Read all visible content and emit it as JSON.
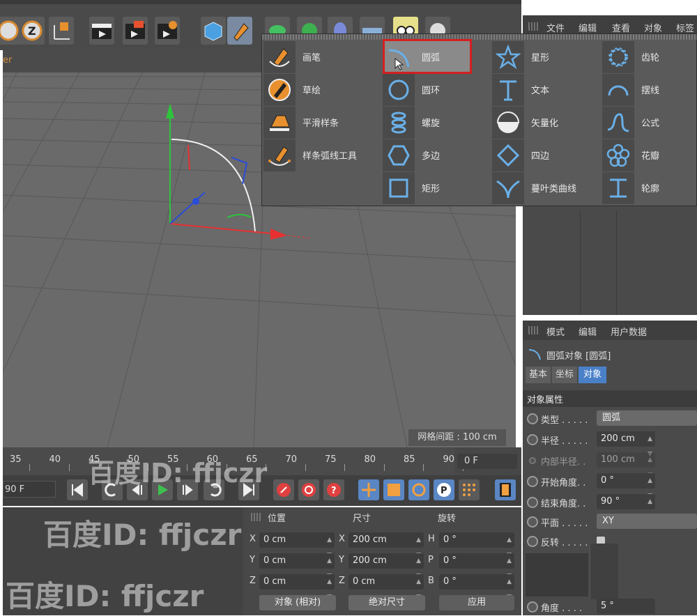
{
  "colors": {
    "accent": "#d89040",
    "highlight": "#d42020",
    "axis_x": "#e83030",
    "axis_y": "#2ec43c",
    "axis_z": "#2a4cd8"
  },
  "viewport": {
    "header_text": "er",
    "grid_spacing": "网格间距 : 100 cm"
  },
  "object_manager": {
    "menu": [
      "文件",
      "编辑",
      "查看",
      "对象",
      "标签"
    ]
  },
  "spline_menu": {
    "columns": [
      [
        {
          "label": "画笔",
          "icon": "pen-icon"
        },
        {
          "label": "草绘",
          "icon": "sketch-icon"
        },
        {
          "label": "平滑样条",
          "icon": "smooth-spline-icon"
        },
        {
          "label": "样条弧线工具",
          "icon": "spline-arc-tool-icon"
        }
      ],
      [
        {
          "label": "圆弧",
          "icon": "arc-icon",
          "selected": true
        },
        {
          "label": "圆环",
          "icon": "circle-icon"
        },
        {
          "label": "螺旋",
          "icon": "helix-icon"
        },
        {
          "label": "多边",
          "icon": "polygon-icon"
        },
        {
          "label": "矩形",
          "icon": "rectangle-icon"
        }
      ],
      [
        {
          "label": "星形",
          "icon": "star-icon"
        },
        {
          "label": "文本",
          "icon": "text-icon"
        },
        {
          "label": "矢量化",
          "icon": "vectorizer-icon"
        },
        {
          "label": "四边",
          "icon": "four-side-icon"
        },
        {
          "label": "蔓叶类曲线",
          "icon": "cissoid-icon"
        }
      ],
      [
        {
          "label": "齿轮",
          "icon": "gear-spline-icon"
        },
        {
          "label": "摆线",
          "icon": "cycloid-icon"
        },
        {
          "label": "公式",
          "icon": "formula-icon"
        },
        {
          "label": "花瓣",
          "icon": "flower-icon"
        },
        {
          "label": "轮廓",
          "icon": "profile-icon"
        }
      ]
    ]
  },
  "attributes": {
    "menu": [
      "模式",
      "编辑",
      "用户数据"
    ],
    "object_title": "圆弧对象 [圆弧]",
    "tabs": [
      "基本",
      "坐标",
      "对象"
    ],
    "section": "对象属性",
    "rows": [
      {
        "label": "类型 . . . . .",
        "value": "圆弧",
        "kind": "drop"
      },
      {
        "label": "半径 . . . . .",
        "value": "200 cm",
        "kind": "field"
      },
      {
        "label": "内部半径. .",
        "value": "100 cm",
        "kind": "field",
        "disabled": true
      },
      {
        "label": "开始角度. .",
        "value": "0 °",
        "kind": "field"
      },
      {
        "label": "结束角度. .",
        "value": "90 °",
        "kind": "field"
      },
      {
        "label": "平面 . . . . .",
        "value": "XY",
        "kind": "drop"
      },
      {
        "label": "反转 . . . . .",
        "value": "",
        "kind": "check"
      }
    ],
    "angle_label": "角度 . . . .",
    "angle_value": "5 °"
  },
  "timeline": {
    "ticks": [
      "35",
      "40",
      "45",
      "50",
      "55",
      "60",
      "65",
      "70",
      "75",
      "80",
      "85",
      "90"
    ],
    "frame_field": "0 F"
  },
  "transport": {
    "end_field": "90 F"
  },
  "coords": {
    "headers": [
      "位置",
      "尺寸",
      "旋转"
    ],
    "rows": [
      {
        "axis": "X",
        "pos": "0 cm",
        "size_axis": "X",
        "size": "200 cm",
        "rot_axis": "H",
        "rot": "0 °"
      },
      {
        "axis": "Y",
        "pos": "0 cm",
        "size_axis": "Y",
        "size": "200 cm",
        "rot_axis": "P",
        "rot": "0 °"
      },
      {
        "axis": "Z",
        "pos": "0 cm",
        "size_axis": "Z",
        "size": "0 cm",
        "rot_axis": "B",
        "rot": "0 °"
      }
    ],
    "mode": "对象 (相对)",
    "size_mode": "绝对尺寸",
    "apply": "应用"
  },
  "watermark": "百度ID: ffjczr"
}
